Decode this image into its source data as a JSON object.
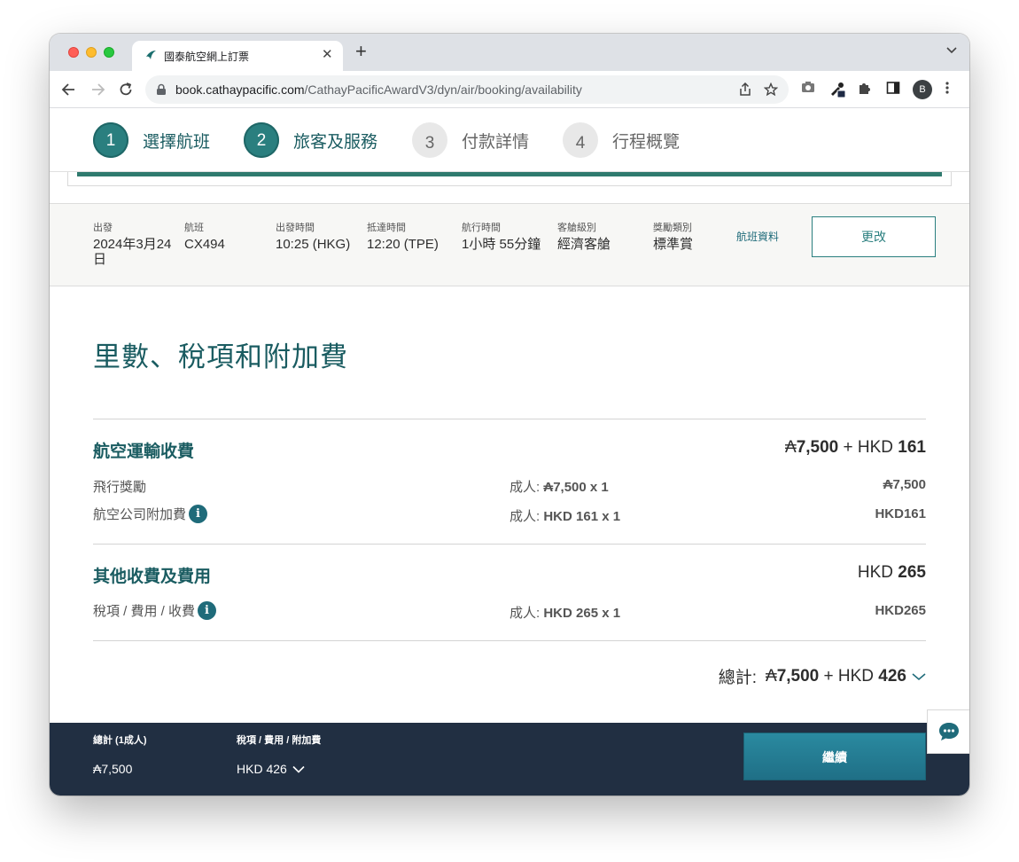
{
  "browser": {
    "tab_title": "國泰航空網上訂票",
    "url_host": "book.cathaypacific.com",
    "url_path": "/CathayPacificAwardV3/dyn/air/booking/availability",
    "profile_initial": "B"
  },
  "steps": [
    {
      "num": "1",
      "label": "選擇航班"
    },
    {
      "num": "2",
      "label": "旅客及服務"
    },
    {
      "num": "3",
      "label": "付款詳情"
    },
    {
      "num": "4",
      "label": "行程概覽"
    }
  ],
  "flight": {
    "date_label": "出發",
    "date_value_line1": "2024年3月24",
    "date_value_line2": "日",
    "flight_label": "航班",
    "flight_value": "CX494",
    "depart_label": "出發時間",
    "depart_value": "10:25 (HKG)",
    "arrive_label": "抵達時間",
    "arrive_value": "12:20 (TPE)",
    "duration_label": "航行時間",
    "duration_value": "1小時 55分鐘",
    "cabin_label": "客艙級別",
    "cabin_value": "經濟客艙",
    "award_label": "獎勵類別",
    "award_value": "標準賞",
    "info_link": "航班資料",
    "change_button": "更改"
  },
  "summary": {
    "title": "里數、稅項和附加費",
    "air": {
      "title": "航空運輸收費",
      "total_miles": "7,500",
      "total_plus": "+ HKD",
      "total_hkd": "161",
      "rows": [
        {
          "label": "飛行獎勵",
          "qty_prefix": "成人:",
          "qty_value": "7,500 x 1",
          "amount": "7,500"
        },
        {
          "label": "航空公司附加費",
          "qty_prefix": "成人:",
          "qty_value": "HKD 161 x 1",
          "amount": "HKD161"
        }
      ]
    },
    "other": {
      "title": "其他收費及費用",
      "total_prefix": "HKD",
      "total_hkd": "265",
      "rows": [
        {
          "label": "稅項 / 費用 / 收費",
          "qty_prefix": "成人:",
          "qty_value": "HKD 265 x 1",
          "amount": "HKD265"
        }
      ]
    },
    "grand": {
      "label": "總計:",
      "miles": "7,500",
      "plus": "+ HKD",
      "hkd": "426"
    }
  },
  "footer": {
    "total_label": "總計 (1成人)",
    "total_value": "7,500",
    "tax_label": "稅項 / 費用 / 附加費",
    "tax_value": "HKD 426",
    "continue_button": "繼續"
  },
  "colors": {
    "brand_teal": "#2a7f7f",
    "footer_navy": "#212f42",
    "button_teal": "#1f6f86"
  }
}
